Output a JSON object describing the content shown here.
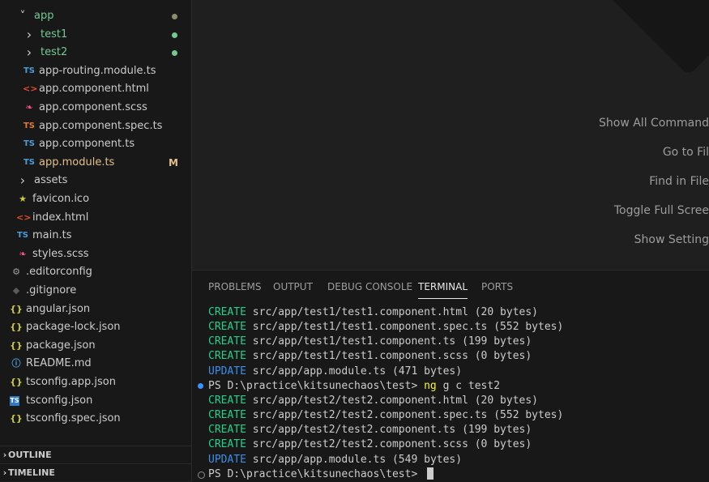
{
  "explorer": {
    "items": [
      {
        "label": "app",
        "chevron": "open",
        "icon": "",
        "decoration": "dot",
        "label_color": "#73c991"
      },
      {
        "label": "test1",
        "chevron": "closed",
        "icon": "",
        "decoration": "dot",
        "label_color": "#73c991"
      },
      {
        "label": "test2",
        "chevron": "closed",
        "icon": "",
        "decoration": "dot",
        "label_color": "#73c991"
      },
      {
        "label": "app-routing.module.ts",
        "chevron": "",
        "icon": "TS",
        "decoration": "",
        "label_color": "#cccccc"
      },
      {
        "label": "app.component.html",
        "chevron": "",
        "icon": "<>",
        "decoration": "",
        "label_color": "#cccccc"
      },
      {
        "label": "app.component.scss",
        "chevron": "",
        "icon": "sass",
        "decoration": "",
        "label_color": "#cccccc"
      },
      {
        "label": "app.component.spec.ts",
        "chevron": "",
        "icon": "TS",
        "decoration": "",
        "label_color": "#cccccc"
      },
      {
        "label": "app.component.ts",
        "chevron": "",
        "icon": "TS",
        "decoration": "",
        "label_color": "#cccccc"
      },
      {
        "label": "app.module.ts",
        "chevron": "",
        "icon": "TS",
        "decoration": "M",
        "label_color": "#e2c08d"
      },
      {
        "label": "assets",
        "chevron": "closed",
        "icon": "",
        "decoration": "",
        "label_color": "#cccccc"
      },
      {
        "label": "favicon.ico",
        "chevron": "",
        "icon": "star",
        "decoration": "",
        "label_color": "#cccccc"
      },
      {
        "label": "index.html",
        "chevron": "",
        "icon": "<>",
        "decoration": "",
        "label_color": "#cccccc"
      },
      {
        "label": "main.ts",
        "chevron": "",
        "icon": "TS",
        "decoration": "",
        "label_color": "#cccccc"
      },
      {
        "label": "styles.scss",
        "chevron": "",
        "icon": "sass",
        "decoration": "",
        "label_color": "#cccccc"
      },
      {
        "label": ".editorconfig",
        "chevron": "",
        "icon": "gear",
        "decoration": "",
        "label_color": "#cccccc"
      },
      {
        "label": ".gitignore",
        "chevron": "",
        "icon": "git",
        "decoration": "",
        "label_color": "#cccccc"
      },
      {
        "label": "angular.json",
        "chevron": "",
        "icon": "{}",
        "decoration": "",
        "label_color": "#cccccc"
      },
      {
        "label": "package-lock.json",
        "chevron": "",
        "icon": "{}",
        "decoration": "",
        "label_color": "#cccccc"
      },
      {
        "label": "package.json",
        "chevron": "",
        "icon": "{}",
        "decoration": "",
        "label_color": "#cccccc"
      },
      {
        "label": "README.md",
        "chevron": "",
        "icon": "info",
        "decoration": "",
        "label_color": "#cccccc"
      },
      {
        "label": "tsconfig.app.json",
        "chevron": "",
        "icon": "{}",
        "decoration": "",
        "label_color": "#cccccc"
      },
      {
        "label": "tsconfig.json",
        "chevron": "",
        "icon": "tsconfig",
        "decoration": "",
        "label_color": "#cccccc"
      },
      {
        "label": "tsconfig.spec.json",
        "chevron": "",
        "icon": "{}",
        "decoration": "",
        "label_color": "#cccccc"
      }
    ],
    "outline_label": "OUTLINE",
    "timeline_label": "TIMELINE"
  },
  "editor": {
    "hints": [
      "Show All Command",
      "Go to Fil",
      "Find in File",
      "Toggle Full Scree",
      "Show Setting"
    ]
  },
  "panel": {
    "tabs": [
      "PROBLEMS",
      "OUTPUT",
      "DEBUG CONSOLE",
      "TERMINAL",
      "PORTS"
    ],
    "active_tab": "TERMINAL",
    "terminal_lines": [
      {
        "kw": "CREATE",
        "text": " src/app/test1/test1.component.html (20 bytes)"
      },
      {
        "kw": "CREATE",
        "text": " src/app/test1/test1.component.spec.ts (552 bytes)"
      },
      {
        "kw": "CREATE",
        "text": " src/app/test1/test1.component.ts (199 bytes)"
      },
      {
        "kw": "CREATE",
        "text": " src/app/test1/test1.component.scss (0 bytes)"
      },
      {
        "kw": "UPDATE",
        "text": " src/app/app.module.ts (471 bytes)"
      },
      {
        "prompt": "PS D:\\practice\\kitsunechaos\\test> ",
        "cmd": "ng",
        "rest": " g c test2",
        "dot": "blue"
      },
      {
        "kw": "CREATE",
        "text": " src/app/test2/test2.component.html (20 bytes)"
      },
      {
        "kw": "CREATE",
        "text": " src/app/test2/test2.component.spec.ts (552 bytes)"
      },
      {
        "kw": "CREATE",
        "text": " src/app/test2/test2.component.ts (199 bytes)"
      },
      {
        "kw": "CREATE",
        "text": " src/app/test2/test2.component.scss (0 bytes)"
      },
      {
        "kw": "UPDATE",
        "text": " src/app/app.module.ts (549 bytes)"
      },
      {
        "prompt": "PS D:\\practice\\kitsunechaos\\test> ",
        "cmd": "",
        "rest": "",
        "dot": "gray",
        "cursor": true
      }
    ]
  },
  "colors": {
    "ts_icon": "#4a9ddb",
    "ts_spec_icon": "#e37933",
    "html_icon": "#e44d26",
    "sass_icon": "#f55385",
    "json_icon": "#cbcb41",
    "git_dot": "#73c991",
    "folder_dot": "#8d8d6b"
  }
}
